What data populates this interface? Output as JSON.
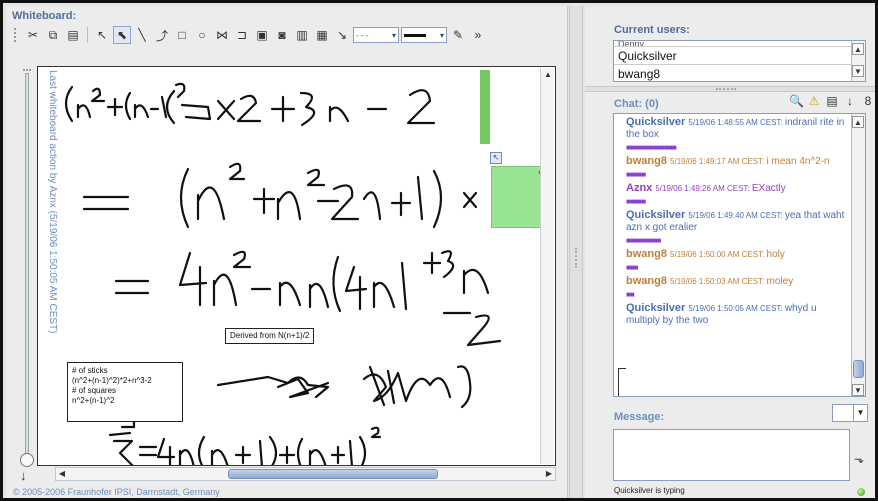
{
  "whiteboard": {
    "title": "Whiteboard:",
    "last_action": "Last whiteboard action by Aznx (5/19/06 1:50:05 AM CEST)",
    "derived_note": "Derived from N(n+1)/2",
    "sticks_note": [
      "# of sticks",
      "(n^2+(n-1)^2)*2+n^3-2",
      "# of squares",
      "n^2+(n-1)^2"
    ],
    "toolbar": [
      "scissors-icon",
      "copy-icon",
      "paste-icon",
      "lasso-icon",
      "select-icon",
      "line-icon",
      "curve-icon",
      "rectangle-icon",
      "ellipse-icon",
      "connector-icon",
      "arrow-shape-icon",
      "image-icon",
      "text-icon",
      "chart-icon",
      "table-icon",
      "link-icon",
      "line-style-select",
      "line-width-select",
      "pen-color-icon",
      "toolbar-overflow-icon"
    ],
    "copyright": "© 2005-2006 Fraunhofer IPSI, Darmstadt, Germany"
  },
  "users": {
    "title": "Current users:",
    "list": [
      "Denny",
      "Quicksilver",
      "bwang8"
    ]
  },
  "chat": {
    "title": "Chat: (0)",
    "messages": [
      {
        "nick": "Quicksilver",
        "time": "5/19/06 1:48:55 AM CEST:",
        "text": "indranil rite in the box",
        "color": "#4a6fb0",
        "sep": "■■■■■■■■■■■■■"
      },
      {
        "nick": "bwang8",
        "time": "5/19/06 1:49:17 AM CEST:",
        "text": "i mean 4n^2-n",
        "color": "#c0803a",
        "sep": "■■■■■"
      },
      {
        "nick": "Aznx",
        "time": "5/19/06 1:49:26 AM CEST:",
        "text": "EXactly",
        "color": "#9a3fc0",
        "sep": "■■■■■"
      },
      {
        "nick": "Quicksilver",
        "time": "5/19/06 1:49:40 AM CEST:",
        "text": "yea that waht azn x got eralier",
        "color": "#4a6fb0",
        "sep": "■■■■■■■■■"
      },
      {
        "nick": "bwang8",
        "time": "5/19/06 1:50:00 AM CEST:",
        "text": "holy",
        "color": "#c0803a",
        "sep": "■■■"
      },
      {
        "nick": "bwang8",
        "time": "5/19/06 1:50:03 AM CEST:",
        "text": "moley",
        "color": "#c0803a",
        "sep": "■■"
      },
      {
        "nick": "Quicksilver",
        "time": "5/19/06 1:50:05 AM CEST:",
        "text": "whyd u multiply by the two",
        "color": "#4a6fb0",
        "sep": ""
      }
    ]
  },
  "message": {
    "title": "Message:",
    "typing_status": "Quicksilver is typing"
  },
  "colors": {
    "accent": "#4d6e9e",
    "highlight": "#8fe08a",
    "sep": "#8a3fd0"
  }
}
